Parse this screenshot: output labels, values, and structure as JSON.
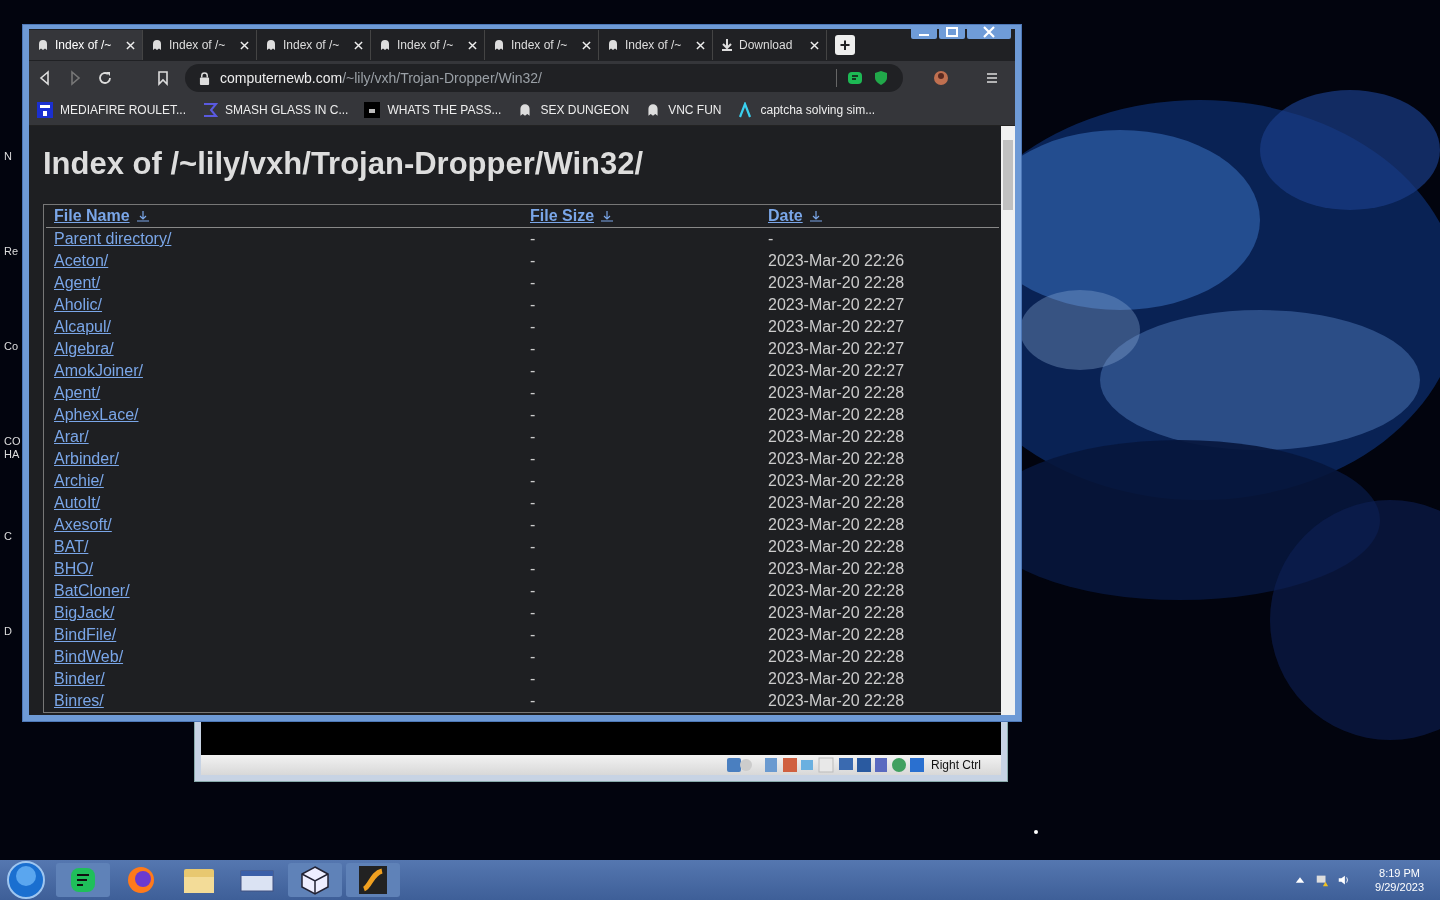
{
  "desktop_icons": [
    "N",
    "Re",
    "Co",
    "CO HA",
    "C",
    "D"
  ],
  "browser": {
    "tabs": [
      {
        "label": "Index of /~",
        "kind": "page",
        "selected": true
      },
      {
        "label": "Index of /~",
        "kind": "page",
        "selected": false
      },
      {
        "label": "Index of /~",
        "kind": "page",
        "selected": false
      },
      {
        "label": "Index of /~",
        "kind": "page",
        "selected": false
      },
      {
        "label": "Index of /~",
        "kind": "page",
        "selected": false
      },
      {
        "label": "Index of /~",
        "kind": "page",
        "selected": false
      },
      {
        "label": "Download",
        "kind": "download",
        "selected": false
      }
    ],
    "new_tab": "+",
    "address": {
      "domain": "computernewb.com",
      "path": "/~lily/vxh/Trojan-Dropper/Win32/"
    },
    "bookmarks": [
      {
        "label": "MEDIAFIRE ROULET...",
        "kind": "mf"
      },
      {
        "label": "SMASH GLASS IN C...",
        "kind": "sigma"
      },
      {
        "label": "WHATS THE PASS...",
        "kind": "dark"
      },
      {
        "label": "SEX DUNGEON",
        "kind": "page"
      },
      {
        "label": "VNC FUN",
        "kind": "page"
      },
      {
        "label": "captcha solving sim...",
        "kind": "lambda"
      }
    ]
  },
  "page": {
    "title": "Index of /~lily/vxh/Trojan-Dropper/Win32/",
    "columns": [
      "File Name",
      "File Size",
      "Date"
    ],
    "rows": [
      {
        "name": "Parent directory/",
        "size": "-",
        "date": "-"
      },
      {
        "name": "Aceton/",
        "size": "-",
        "date": "2023-Mar-20 22:26"
      },
      {
        "name": "Agent/",
        "size": "-",
        "date": "2023-Mar-20 22:28"
      },
      {
        "name": "Aholic/",
        "size": "-",
        "date": "2023-Mar-20 22:27"
      },
      {
        "name": "Alcapul/",
        "size": "-",
        "date": "2023-Mar-20 22:27"
      },
      {
        "name": "Algebra/",
        "size": "-",
        "date": "2023-Mar-20 22:27"
      },
      {
        "name": "AmokJoiner/",
        "size": "-",
        "date": "2023-Mar-20 22:27"
      },
      {
        "name": "Apent/",
        "size": "-",
        "date": "2023-Mar-20 22:28"
      },
      {
        "name": "AphexLace/",
        "size": "-",
        "date": "2023-Mar-20 22:28"
      },
      {
        "name": "Arar/",
        "size": "-",
        "date": "2023-Mar-20 22:28"
      },
      {
        "name": "Arbinder/",
        "size": "-",
        "date": "2023-Mar-20 22:28"
      },
      {
        "name": "Archie/",
        "size": "-",
        "date": "2023-Mar-20 22:28"
      },
      {
        "name": "AutoIt/",
        "size": "-",
        "date": "2023-Mar-20 22:28"
      },
      {
        "name": "Axesoft/",
        "size": "-",
        "date": "2023-Mar-20 22:28"
      },
      {
        "name": "BAT/",
        "size": "-",
        "date": "2023-Mar-20 22:28"
      },
      {
        "name": "BHO/",
        "size": "-",
        "date": "2023-Mar-20 22:28"
      },
      {
        "name": "BatCloner/",
        "size": "-",
        "date": "2023-Mar-20 22:28"
      },
      {
        "name": "BigJack/",
        "size": "-",
        "date": "2023-Mar-20 22:28"
      },
      {
        "name": "BindFile/",
        "size": "-",
        "date": "2023-Mar-20 22:28"
      },
      {
        "name": "BindWeb/",
        "size": "-",
        "date": "2023-Mar-20 22:28"
      },
      {
        "name": "Binder/",
        "size": "-",
        "date": "2023-Mar-20 22:28"
      },
      {
        "name": "Binres/",
        "size": "-",
        "date": "2023-Mar-20 22:28"
      }
    ]
  },
  "vm_status": {
    "host_key": "Right Ctrl"
  },
  "taskbar": {
    "time": "8:19 PM",
    "date": "9/29/2023"
  }
}
